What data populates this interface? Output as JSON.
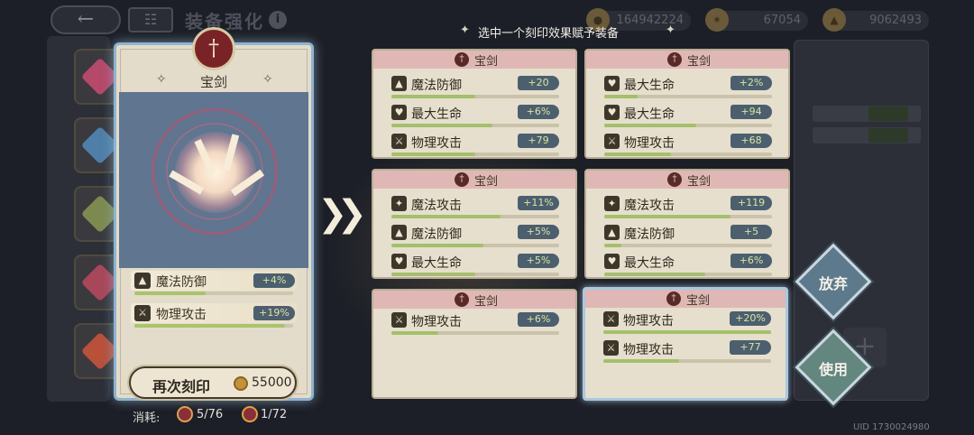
{
  "header": {
    "back_icon": "back-arrow-icon",
    "grid_icon": "grid-icon",
    "title": "装备强化",
    "currencies": [
      {
        "icon": "gold-coin-icon",
        "value": "164942224"
      },
      {
        "icon": "crystal-icon",
        "value": "67054"
      },
      {
        "icon": "resource-bag-icon",
        "value": "9062493"
      }
    ]
  },
  "instruction": "选中一个刻印效果赋予装备",
  "equipment": {
    "name": "宝剑",
    "stats": [
      {
        "icon": "hat-icon",
        "name": "魔法防御",
        "value": "+4%",
        "fill": 0.45
      },
      {
        "icon": "sword-icon",
        "name": "物理攻击",
        "value": "+19%",
        "fill": 0.95
      }
    ]
  },
  "reforge": {
    "label": "再次刻印",
    "cost": "55000",
    "consume_label": "消耗:",
    "materials": [
      {
        "icon": "engrave-stone-icon",
        "count": "5/76"
      },
      {
        "icon": "rare-stone-icon",
        "count": "1/72"
      }
    ]
  },
  "options": [
    {
      "title": "宝剑",
      "selected": false,
      "stats": [
        {
          "icon": "hat-icon",
          "name": "魔法防御",
          "value": "+20",
          "fill": 0.5
        },
        {
          "icon": "heart-icon",
          "name": "最大生命",
          "value": "+6%",
          "fill": 0.6
        },
        {
          "icon": "sword-icon",
          "name": "物理攻击",
          "value": "+79",
          "fill": 0.5
        }
      ]
    },
    {
      "title": "宝剑",
      "selected": false,
      "stats": [
        {
          "icon": "heart-icon",
          "name": "最大生命",
          "value": "+2%",
          "fill": 0.2
        },
        {
          "icon": "heart-icon",
          "name": "最大生命",
          "value": "+94",
          "fill": 0.55
        },
        {
          "icon": "sword-icon",
          "name": "物理攻击",
          "value": "+68",
          "fill": 0.4
        }
      ]
    },
    {
      "title": "宝剑",
      "selected": false,
      "stats": [
        {
          "icon": "wand-icon",
          "name": "魔法攻击",
          "value": "+11%",
          "fill": 0.65
        },
        {
          "icon": "hat-icon",
          "name": "魔法防御",
          "value": "+5%",
          "fill": 0.55
        },
        {
          "icon": "heart-icon",
          "name": "最大生命",
          "value": "+5%",
          "fill": 0.5
        }
      ]
    },
    {
      "title": "宝剑",
      "selected": false,
      "stats": [
        {
          "icon": "wand-icon",
          "name": "魔法攻击",
          "value": "+119",
          "fill": 0.75
        },
        {
          "icon": "hat-icon",
          "name": "魔法防御",
          "value": "+5",
          "fill": 0.1
        },
        {
          "icon": "heart-icon",
          "name": "最大生命",
          "value": "+6%",
          "fill": 0.6
        }
      ]
    },
    {
      "title": "宝剑",
      "selected": false,
      "stats": [
        {
          "icon": "sword-icon",
          "name": "物理攻击",
          "value": "+6%",
          "fill": 0.28
        }
      ]
    },
    {
      "title": "宝剑",
      "selected": true,
      "stats": [
        {
          "icon": "sword-icon",
          "name": "物理攻击",
          "value": "+20%",
          "fill": 1.0
        },
        {
          "icon": "sword-icon",
          "name": "物理攻击",
          "value": "+77",
          "fill": 0.45
        }
      ]
    }
  ],
  "actions": {
    "discard": "放弃",
    "use": "使用"
  },
  "footer": {
    "uid": "UID 1730024980"
  },
  "colors": {
    "card_bg": "#e6dfcd",
    "header_pink": "#dfb8b5",
    "value_tag": "#4c5f6e",
    "value_text": "#d8e5a0",
    "progress_fill": "#a3c06a",
    "selected_border": "#a9c7e0"
  }
}
